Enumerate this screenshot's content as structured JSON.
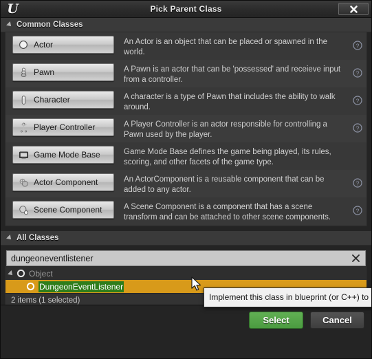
{
  "window": {
    "title": "Pick Parent Class",
    "logo_glyph": "U",
    "close_icon": "close-icon"
  },
  "common_section": {
    "header": "Common Classes",
    "classes": [
      {
        "label": "Actor",
        "icon": "actor-sphere-icon",
        "description": "An Actor is an object that can be placed or spawned in the world.",
        "has_help": true
      },
      {
        "label": "Pawn",
        "icon": "pawn-icon",
        "description": "A Pawn is an actor that can be 'possessed' and receieve input from a controller.",
        "has_help": true
      },
      {
        "label": "Character",
        "icon": "character-capsule-icon",
        "description": "A character is a type of Pawn that includes the ability to walk around.",
        "has_help": true
      },
      {
        "label": "Player Controller",
        "icon": "player-controller-icon",
        "description": "A Player Controller is an actor responsible for controlling a Pawn used by the player.",
        "has_help": true
      },
      {
        "label": "Game Mode Base",
        "icon": "game-mode-base-icon",
        "description": "Game Mode Base defines the game being played, its rules, scoring, and other facets of the game type.",
        "has_help": false
      },
      {
        "label": "Actor Component",
        "icon": "actor-component-icon",
        "description": "An ActorComponent is a reusable component that can be added to any actor.",
        "has_help": true
      },
      {
        "label": "Scene Component",
        "icon": "scene-component-icon",
        "description": "A Scene Component is a component that has a scene transform and can be attached to other scene components.",
        "has_help": true
      }
    ]
  },
  "all_section": {
    "header": "All Classes",
    "search": {
      "value": "dungeoneventlistener",
      "placeholder": "Search Classes",
      "clear_icon": "clear-icon"
    },
    "tree": [
      {
        "label": "Object",
        "match": "",
        "rest": "Object",
        "indent": 0,
        "expanded": true,
        "selected": false,
        "icon": "class-circle-icon"
      },
      {
        "label": "DungeonEventListener",
        "match": "DungeonEventListener",
        "rest": "",
        "indent": 1,
        "expanded": false,
        "selected": true,
        "icon": "class-circle-icon"
      }
    ],
    "status": "2 items (1 selected)"
  },
  "tooltip": {
    "text": "Implement this class in blueprint (or C++) to"
  },
  "footer": {
    "select_label": "Select",
    "cancel_label": "Cancel"
  },
  "colors": {
    "selection_orange": "#d89a1a",
    "match_green": "#2e7d1b",
    "select_button_green": "#4b9b40",
    "panel_bg": "#383838",
    "window_bg": "#242424"
  }
}
